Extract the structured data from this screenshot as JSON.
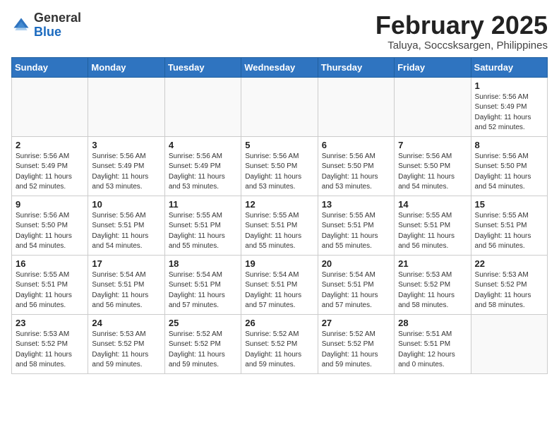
{
  "header": {
    "logo_general": "General",
    "logo_blue": "Blue",
    "month_year": "February 2025",
    "location": "Taluya, Soccsksargen, Philippines"
  },
  "weekdays": [
    "Sunday",
    "Monday",
    "Tuesday",
    "Wednesday",
    "Thursday",
    "Friday",
    "Saturday"
  ],
  "weeks": [
    [
      {
        "day": "",
        "info": ""
      },
      {
        "day": "",
        "info": ""
      },
      {
        "day": "",
        "info": ""
      },
      {
        "day": "",
        "info": ""
      },
      {
        "day": "",
        "info": ""
      },
      {
        "day": "",
        "info": ""
      },
      {
        "day": "1",
        "info": "Sunrise: 5:56 AM\nSunset: 5:49 PM\nDaylight: 11 hours\nand 52 minutes."
      }
    ],
    [
      {
        "day": "2",
        "info": "Sunrise: 5:56 AM\nSunset: 5:49 PM\nDaylight: 11 hours\nand 52 minutes."
      },
      {
        "day": "3",
        "info": "Sunrise: 5:56 AM\nSunset: 5:49 PM\nDaylight: 11 hours\nand 53 minutes."
      },
      {
        "day": "4",
        "info": "Sunrise: 5:56 AM\nSunset: 5:49 PM\nDaylight: 11 hours\nand 53 minutes."
      },
      {
        "day": "5",
        "info": "Sunrise: 5:56 AM\nSunset: 5:50 PM\nDaylight: 11 hours\nand 53 minutes."
      },
      {
        "day": "6",
        "info": "Sunrise: 5:56 AM\nSunset: 5:50 PM\nDaylight: 11 hours\nand 53 minutes."
      },
      {
        "day": "7",
        "info": "Sunrise: 5:56 AM\nSunset: 5:50 PM\nDaylight: 11 hours\nand 54 minutes."
      },
      {
        "day": "8",
        "info": "Sunrise: 5:56 AM\nSunset: 5:50 PM\nDaylight: 11 hours\nand 54 minutes."
      }
    ],
    [
      {
        "day": "9",
        "info": "Sunrise: 5:56 AM\nSunset: 5:50 PM\nDaylight: 11 hours\nand 54 minutes."
      },
      {
        "day": "10",
        "info": "Sunrise: 5:56 AM\nSunset: 5:51 PM\nDaylight: 11 hours\nand 54 minutes."
      },
      {
        "day": "11",
        "info": "Sunrise: 5:55 AM\nSunset: 5:51 PM\nDaylight: 11 hours\nand 55 minutes."
      },
      {
        "day": "12",
        "info": "Sunrise: 5:55 AM\nSunset: 5:51 PM\nDaylight: 11 hours\nand 55 minutes."
      },
      {
        "day": "13",
        "info": "Sunrise: 5:55 AM\nSunset: 5:51 PM\nDaylight: 11 hours\nand 55 minutes."
      },
      {
        "day": "14",
        "info": "Sunrise: 5:55 AM\nSunset: 5:51 PM\nDaylight: 11 hours\nand 56 minutes."
      },
      {
        "day": "15",
        "info": "Sunrise: 5:55 AM\nSunset: 5:51 PM\nDaylight: 11 hours\nand 56 minutes."
      }
    ],
    [
      {
        "day": "16",
        "info": "Sunrise: 5:55 AM\nSunset: 5:51 PM\nDaylight: 11 hours\nand 56 minutes."
      },
      {
        "day": "17",
        "info": "Sunrise: 5:54 AM\nSunset: 5:51 PM\nDaylight: 11 hours\nand 56 minutes."
      },
      {
        "day": "18",
        "info": "Sunrise: 5:54 AM\nSunset: 5:51 PM\nDaylight: 11 hours\nand 57 minutes."
      },
      {
        "day": "19",
        "info": "Sunrise: 5:54 AM\nSunset: 5:51 PM\nDaylight: 11 hours\nand 57 minutes."
      },
      {
        "day": "20",
        "info": "Sunrise: 5:54 AM\nSunset: 5:51 PM\nDaylight: 11 hours\nand 57 minutes."
      },
      {
        "day": "21",
        "info": "Sunrise: 5:53 AM\nSunset: 5:52 PM\nDaylight: 11 hours\nand 58 minutes."
      },
      {
        "day": "22",
        "info": "Sunrise: 5:53 AM\nSunset: 5:52 PM\nDaylight: 11 hours\nand 58 minutes."
      }
    ],
    [
      {
        "day": "23",
        "info": "Sunrise: 5:53 AM\nSunset: 5:52 PM\nDaylight: 11 hours\nand 58 minutes."
      },
      {
        "day": "24",
        "info": "Sunrise: 5:53 AM\nSunset: 5:52 PM\nDaylight: 11 hours\nand 59 minutes."
      },
      {
        "day": "25",
        "info": "Sunrise: 5:52 AM\nSunset: 5:52 PM\nDaylight: 11 hours\nand 59 minutes."
      },
      {
        "day": "26",
        "info": "Sunrise: 5:52 AM\nSunset: 5:52 PM\nDaylight: 11 hours\nand 59 minutes."
      },
      {
        "day": "27",
        "info": "Sunrise: 5:52 AM\nSunset: 5:52 PM\nDaylight: 11 hours\nand 59 minutes."
      },
      {
        "day": "28",
        "info": "Sunrise: 5:51 AM\nSunset: 5:51 PM\nDaylight: 12 hours\nand 0 minutes."
      },
      {
        "day": "",
        "info": ""
      }
    ]
  ]
}
